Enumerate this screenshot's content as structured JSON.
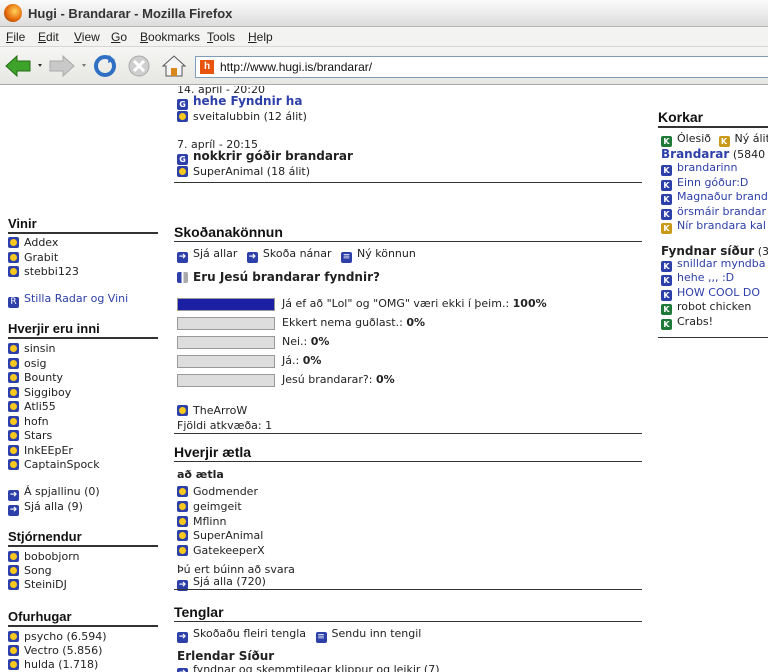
{
  "window": {
    "title": "Hugi - Brandarar - Mozilla Firefox"
  },
  "menu": [
    "File",
    "Edit",
    "View",
    "Go",
    "Bookmarks",
    "Tools",
    "Help"
  ],
  "url": "http://www.hugi.is/brandarar/",
  "threads": [
    {
      "date": "14. apríl - 20:20",
      "title": "hehe Fyndnir ha",
      "user": "sveitalubbin (12 álit)"
    },
    {
      "date": "7. apríl - 20:15",
      "title": "nokkrir góðir brandarar",
      "user": "SuperAnimal (18 álit)"
    }
  ],
  "left": {
    "vinir": {
      "heading": "Vinir",
      "items": [
        "Addex",
        "Grabit",
        "stebbi123"
      ],
      "settings": "Stilla Radar og Vini"
    },
    "inni": {
      "heading": "Hverjir eru inni",
      "items": [
        "sinsin",
        "osig",
        "Bounty",
        "Siggiboy",
        "Atli55",
        "hofn",
        "Stars",
        "InkEEpEr",
        "CaptainSpock"
      ],
      "chat": "Á spjallinu (0)",
      "all": "Sjá alla (9)"
    },
    "stjorn": {
      "heading": "Stjórnendur",
      "items": [
        "bobobjorn",
        "Song",
        "SteiniDJ"
      ]
    },
    "ofur": {
      "heading": "Ofurhugar",
      "items": [
        "psycho (6.594)",
        "Vectro (5.856)",
        "hulda (1.718)"
      ]
    }
  },
  "poll": {
    "heading": "Skoðanakönnun",
    "links": [
      "Sjá allar",
      "Skoða nánar",
      "Ný könnun"
    ],
    "question": "Eru Jesú brandarar fyndnir?",
    "options": [
      {
        "label": "Já ef að \"Lol\" og \"OMG\" væri ekki í þeim.:",
        "pct": "100%",
        "fraction": 1.0
      },
      {
        "label": "Ekkert nema guðlast.:",
        "pct": "0%",
        "fraction": 0
      },
      {
        "label": "Nei.:",
        "pct": "0%",
        "fraction": 0
      },
      {
        "label": "Já.:",
        "pct": "0%",
        "fraction": 0
      },
      {
        "label": "Jesú brandarar?:",
        "pct": "0%",
        "fraction": 0
      }
    ],
    "author": "TheArroW",
    "votes": "Fjöldi atkvæða: 1"
  },
  "aetla": {
    "heading": "Hverjir ætla",
    "sub": "að ætla",
    "items": [
      "Godmender",
      "geimgeit",
      "Mflinn",
      "SuperAnimal",
      "GatekeeperX"
    ],
    "answered": "Þú ert búinn að svara",
    "all": "Sjá alla (720)"
  },
  "tenglar": {
    "heading": "Tenglar",
    "links": [
      "Skoðaðu fleiri tengla",
      "Sendu inn tengil"
    ],
    "sub": "Erlendar Síður",
    "first": "fyndnar og skemmtilegar klippur og leikir (7)"
  },
  "korkar": {
    "heading": "Korkar",
    "flags": [
      "Ólesið",
      "Ný álit"
    ],
    "forum": "Brandarar",
    "forum_count": "(5840",
    "items": [
      "brandarinn",
      "Einn góður:D",
      "Magnaður brand",
      "örsmáir brandar",
      "Nír brandara kal"
    ],
    "sites_heading": "Fyndnar síður",
    "sites_count": "(3",
    "sites": [
      "snilldar myndba",
      "hehe ,,, :D",
      "HOW COOL DO",
      "robot chicken",
      "Crabs!"
    ]
  }
}
